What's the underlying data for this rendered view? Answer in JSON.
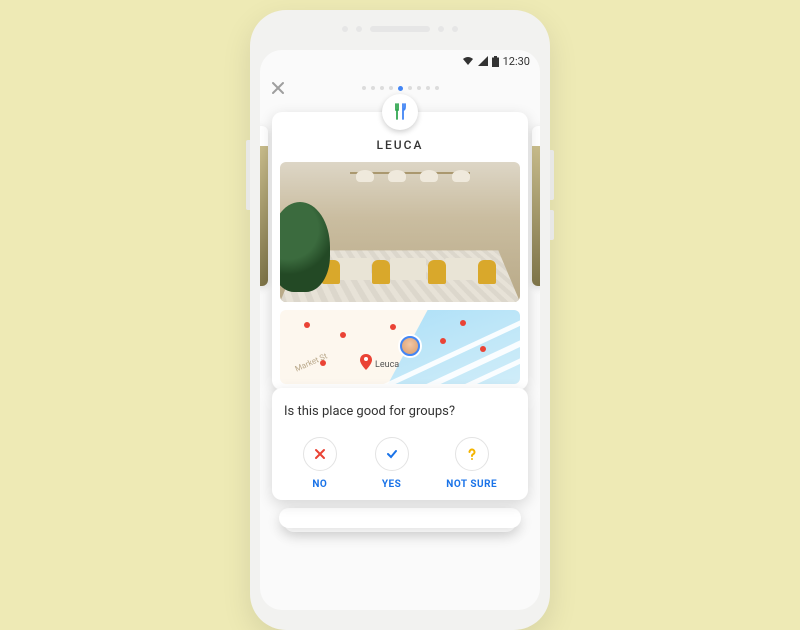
{
  "statusbar": {
    "time": "12:30"
  },
  "progress": {
    "total": 9,
    "active_index": 4
  },
  "place": {
    "name": "LEUCA",
    "category_icon": "fork-knife-icon",
    "map_label": "Leuca",
    "road_label": "Market St"
  },
  "question": {
    "text": "Is this place good for groups?",
    "answers": {
      "no": "NO",
      "yes": "YES",
      "not_sure": "NOT SURE"
    }
  },
  "icons": {
    "no_color": "#ea4335",
    "yes_color": "#1a73e8",
    "notsure_color": "#f4b400"
  }
}
